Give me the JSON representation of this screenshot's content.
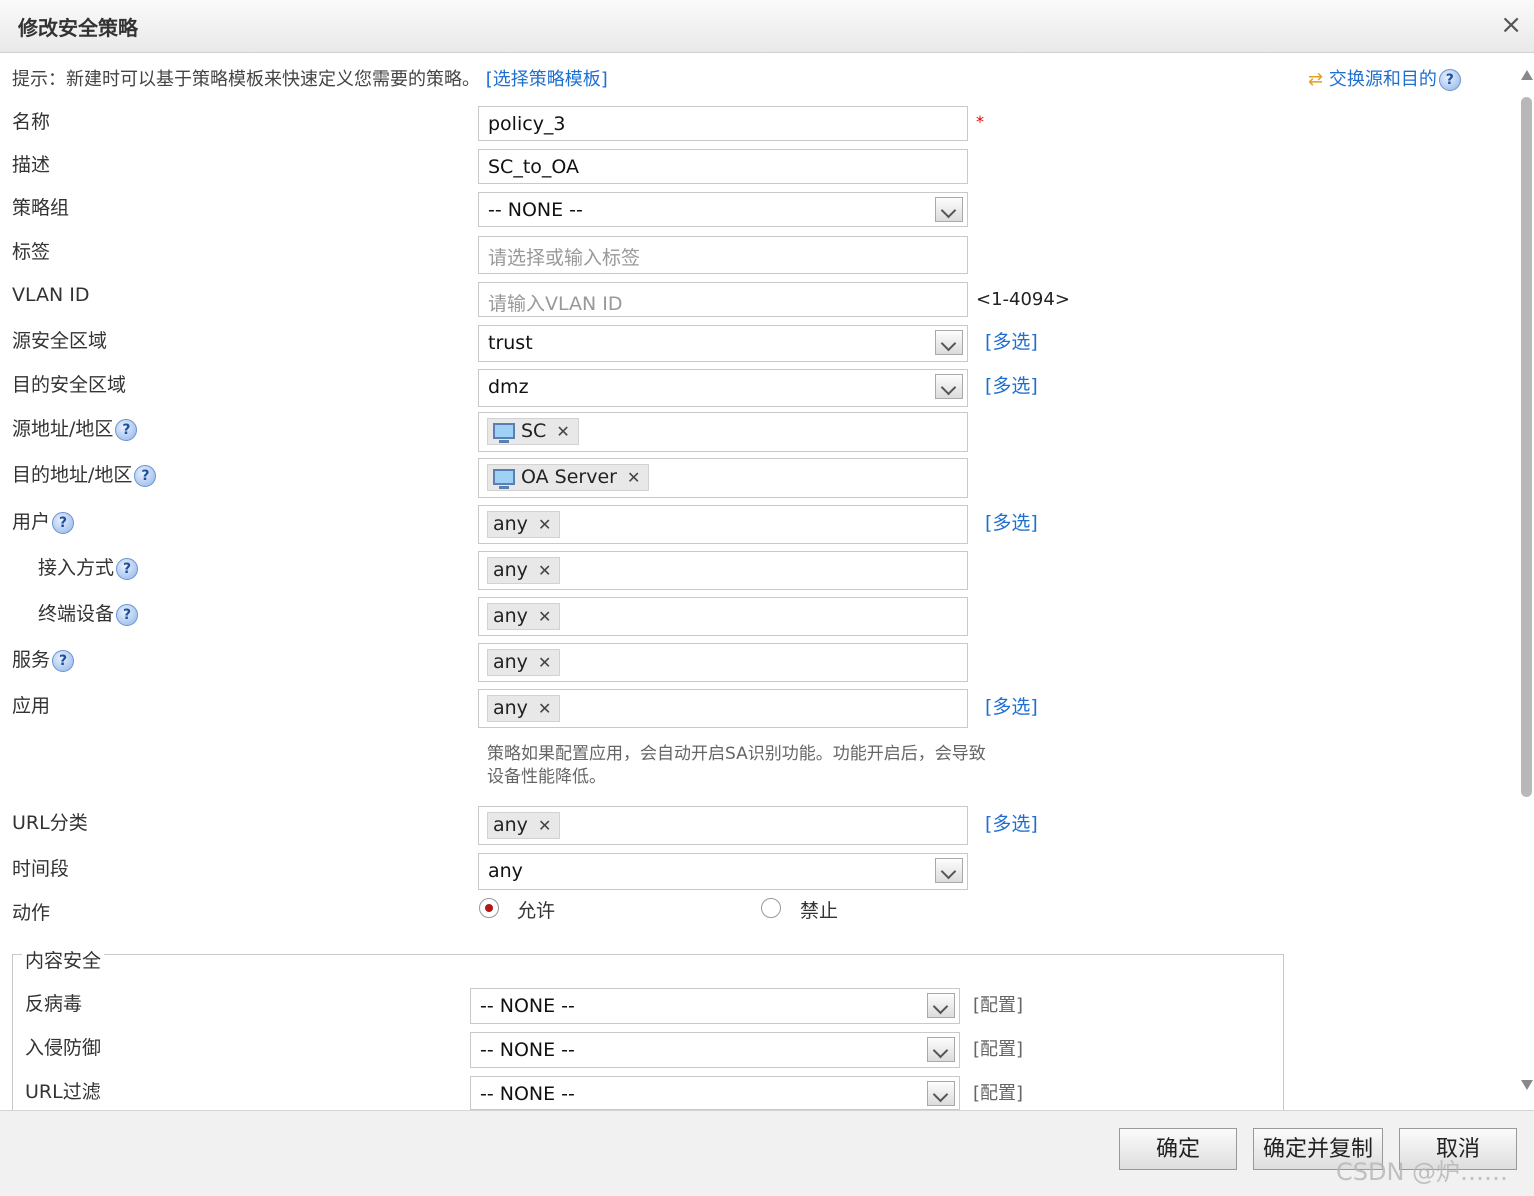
{
  "dialog": {
    "title": "修改安全策略",
    "close": "×"
  },
  "hint": {
    "text": "提示：新建时可以基于策略模板来快速定义您需要的策略。",
    "link": "[选择策略模板]",
    "swap": "交换源和目的"
  },
  "help_glyph": "?",
  "multi_label": "[多选]",
  "form": {
    "name": {
      "label": "名称",
      "value": "policy_3",
      "required": "*"
    },
    "desc": {
      "label": "描述",
      "value": "SC_to_OA"
    },
    "group": {
      "label": "策略组",
      "value": "-- NONE --"
    },
    "tags": {
      "label": "标签",
      "placeholder": "请选择或输入标签"
    },
    "vlan": {
      "label": "VLAN ID",
      "placeholder": "请输入VLAN ID",
      "range": "<1-4094>"
    },
    "src_zone": {
      "label": "源安全区域",
      "value": "trust"
    },
    "dst_zone": {
      "label": "目的安全区域",
      "value": "dmz"
    },
    "src_addr": {
      "label": "源地址/地区",
      "tag": "SC"
    },
    "dst_addr": {
      "label": "目的地址/地区",
      "tag": "OA Server"
    },
    "user": {
      "label": "用户",
      "tag": "any"
    },
    "access": {
      "label": "接入方式",
      "tag": "any"
    },
    "device": {
      "label": "终端设备",
      "tag": "any"
    },
    "service": {
      "label": "服务",
      "tag": "any"
    },
    "app": {
      "label": "应用",
      "tag": "any",
      "note": "策略如果配置应用，会自动开启SA识别功能。功能开启后，会导致设备性能降低。"
    },
    "url_cat": {
      "label": "URL分类",
      "tag": "any"
    },
    "time": {
      "label": "时间段",
      "value": "any"
    },
    "action": {
      "label": "动作",
      "allow": "允许",
      "deny": "禁止",
      "selected": "允许"
    }
  },
  "content_security": {
    "legend": "内容安全",
    "config_label": "[配置]",
    "antivirus": {
      "label": "反病毒",
      "value": "-- NONE --"
    },
    "ips": {
      "label": "入侵防御",
      "value": "-- NONE --"
    },
    "url_filter": {
      "label": "URL过滤",
      "value": "-- NONE --"
    }
  },
  "footer": {
    "ok": "确定",
    "ok_copy": "确定并复制",
    "cancel": "取消"
  },
  "watermark": "CSDN @炉……",
  "colors": {
    "link": "#1f6fd1",
    "required": "#dd0000",
    "radio_selected": "#b01818"
  }
}
